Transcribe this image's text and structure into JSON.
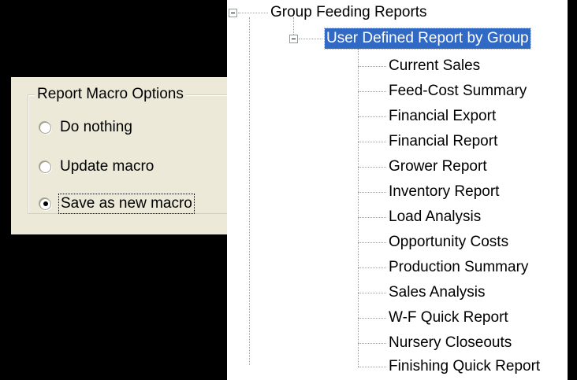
{
  "macro_options": {
    "title": "Report Macro Options",
    "options": [
      {
        "label": "Do nothing",
        "checked": false
      },
      {
        "label": "Update macro",
        "checked": false
      },
      {
        "label": "Save as new macro",
        "checked": true
      }
    ]
  },
  "tree": {
    "root": {
      "label": "Group Feeding Reports",
      "expanded": true
    },
    "group": {
      "label": "User Defined Report by Group",
      "expanded": true,
      "selected": true
    },
    "items": [
      "Current Sales",
      "Feed-Cost Summary",
      "Financial Export",
      "Financial Report",
      "Grower Report",
      "Inventory Report",
      "Load Analysis",
      "Opportunity Costs",
      "Production Summary",
      "Sales Analysis",
      "W-F Quick Report",
      "Nursery Closeouts",
      "Finishing Quick Report"
    ]
  },
  "colors": {
    "selection": "#316AC5",
    "dialog_bg": "#ECE9D8",
    "tree_bg": "#FFFFFF"
  }
}
